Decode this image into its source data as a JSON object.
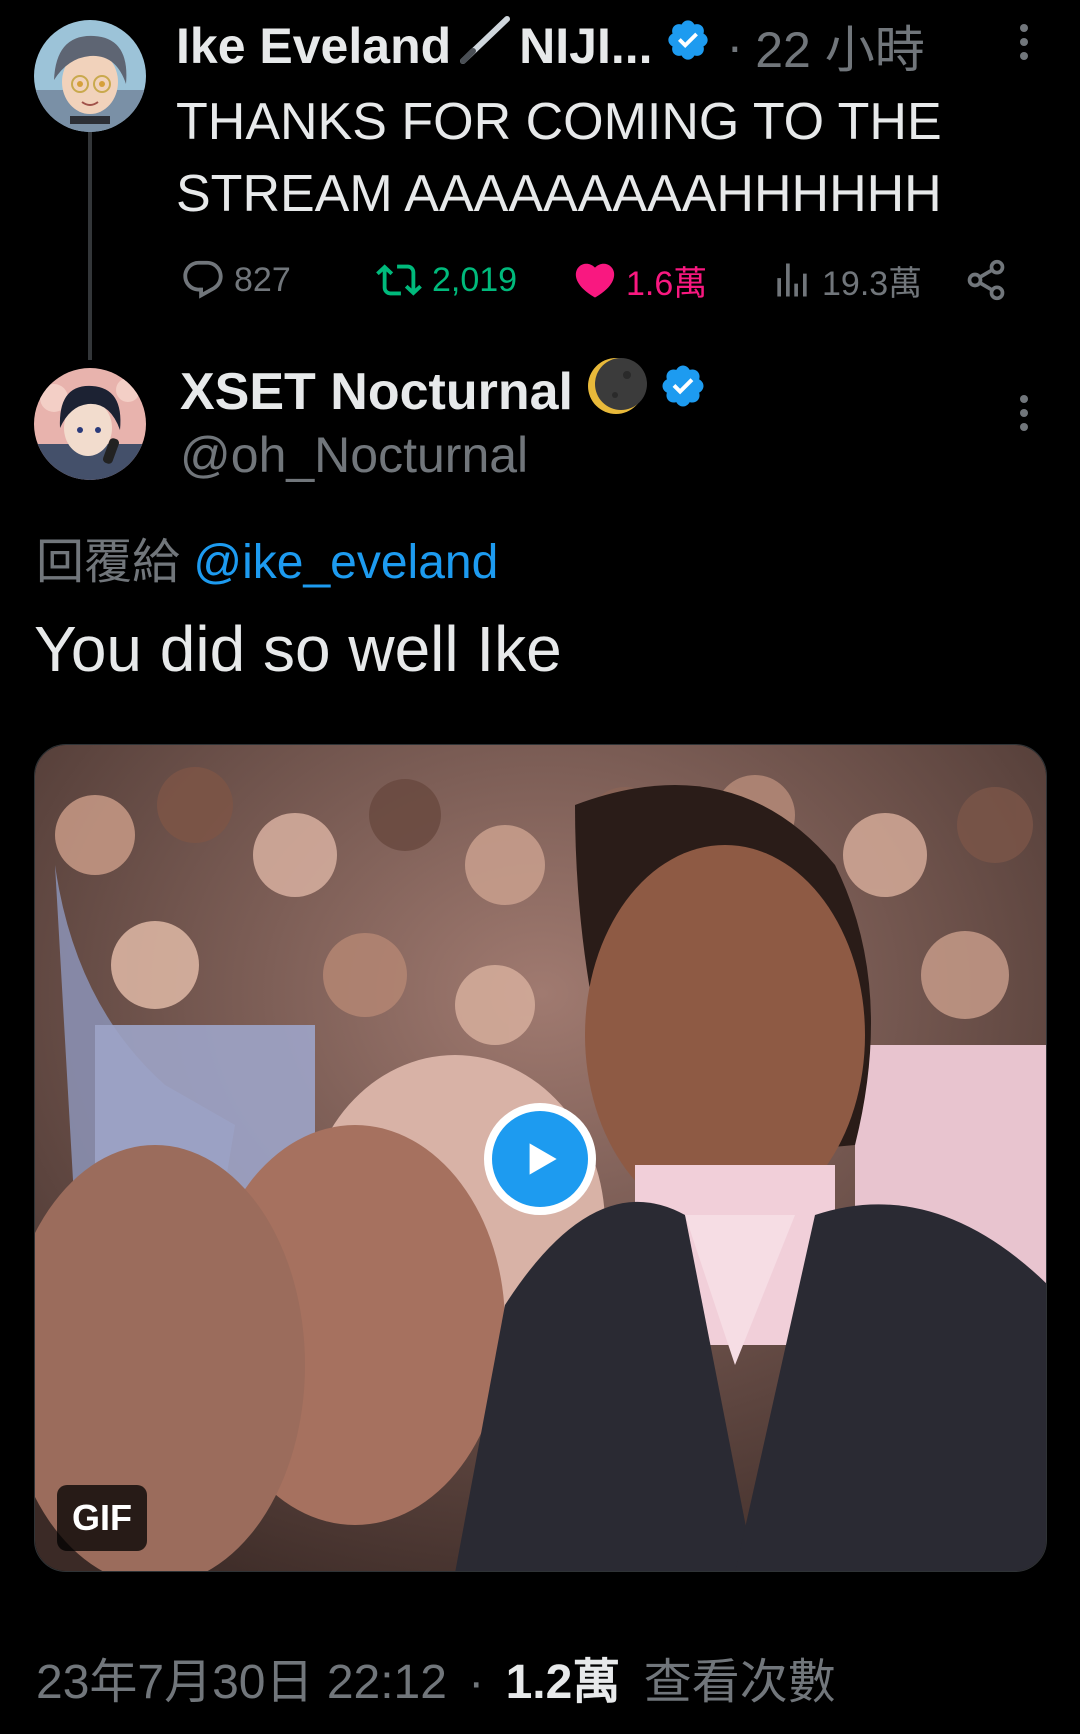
{
  "parent_tweet": {
    "display_name": "Ike Eveland",
    "name_suffix": "NIJI...",
    "separator": "·",
    "time": "22 小時",
    "text_line1": "THANKS FOR COMING TO THE",
    "text_line2": "STREAM AAAAAAAAAHHHHHH",
    "stats": {
      "replies": "827",
      "retweets": "2,019",
      "likes": "1.6萬",
      "views": "19.3萬"
    }
  },
  "reply_tweet": {
    "display_name": "XSET Nocturnal",
    "handle": "@oh_Nocturnal",
    "reply_label": "回覆給",
    "reply_to_handle": "@ike_eveland",
    "text": "You did so well Ike",
    "media_badge": "GIF",
    "timestamp": "23年7月30日 22:12",
    "separator": "·",
    "view_count": "1.2萬",
    "view_label": "查看次數"
  },
  "colors": {
    "background": "#000000",
    "text_primary": "#e7e9ea",
    "text_secondary": "#71767b",
    "accent": "#1d9bf0",
    "retweet": "#00ba7c",
    "like": "#f91880"
  },
  "icons": {
    "verified": "verified-badge-icon",
    "pen": "fountain-pen-emoji-icon",
    "moon": "crescent-moon-emoji-icon",
    "more": "more-vertical-icon",
    "reply": "reply-icon",
    "retweet": "retweet-icon",
    "like": "heart-icon",
    "views": "views-icon",
    "share": "share-icon",
    "play": "play-icon"
  }
}
